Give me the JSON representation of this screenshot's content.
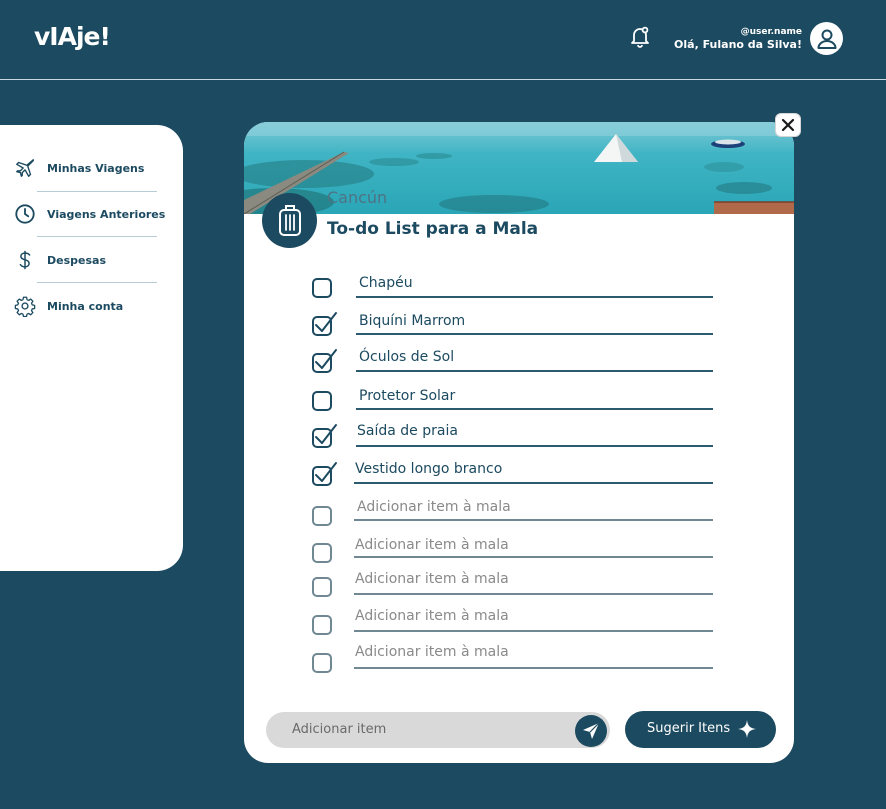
{
  "header": {
    "logo": "vIAje!",
    "username": "@user.name",
    "greeting": "Olá, Fulano da Silva!"
  },
  "sidebar": {
    "items": [
      {
        "label": "Minhas Viagens",
        "icon": "airplane-icon"
      },
      {
        "label": "Viagens Anteriores",
        "icon": "clock-icon"
      },
      {
        "label": "Despesas",
        "icon": "dollar-icon"
      },
      {
        "label": "Minha conta",
        "icon": "gear-icon"
      }
    ]
  },
  "card": {
    "destination": "Cancún",
    "title": "To-do List para a Mala",
    "items": [
      {
        "label": "Chapéu",
        "checked": false
      },
      {
        "label": "Biquíni Marrom",
        "checked": true
      },
      {
        "label": "Óculos de Sol",
        "checked": true
      },
      {
        "label": "Protetor Solar",
        "checked": false
      },
      {
        "label": "Saída de praia",
        "checked": true
      },
      {
        "label": "Vestido longo branco",
        "checked": true
      }
    ],
    "placeholders": [
      "Adicionar item à mala",
      "Adicionar item à mala",
      "Adicionar item à mala",
      "Adicionar item à mala",
      "Adicionar item à mala"
    ],
    "add_input_placeholder": "Adicionar item",
    "suggest_label": "Sugerir Itens"
  },
  "colors": {
    "primary": "#1c4a60",
    "background": "#1c4a60",
    "surface": "#ffffff",
    "input_bg": "#d9d9d9"
  }
}
